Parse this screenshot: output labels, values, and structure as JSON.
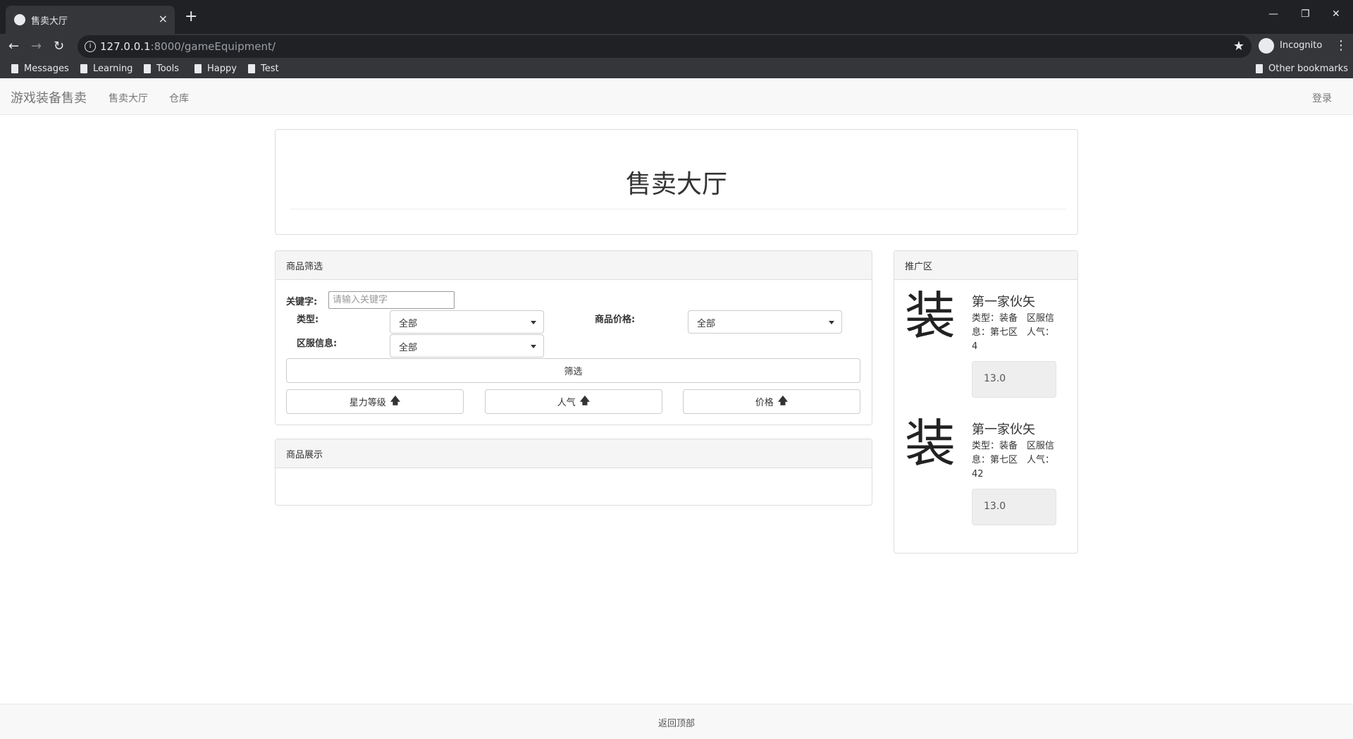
{
  "browser": {
    "tab_title": "售卖大厅",
    "tab_close": "×",
    "new_tab": "+",
    "url_host": "127.0.0.1",
    "url_rest": ":8000/gameEquipment/",
    "incognito_label": "Incognito",
    "bookmarks": [
      "Messages",
      "Learning",
      "Tools",
      "Happy",
      "Test"
    ],
    "other_bookmarks": "Other bookmarks"
  },
  "navbar": {
    "brand": "游戏装备售卖",
    "links": [
      "售卖大厅",
      "仓库"
    ],
    "login": "登录"
  },
  "header": {
    "title": "售卖大厅"
  },
  "filter": {
    "heading": "商品筛选",
    "keyword_label": "关键字:",
    "keyword_placeholder": "请输入关键字",
    "type_label": "类型:",
    "type_value": "全部",
    "price_label": "商品价格:",
    "price_value": "全部",
    "server_label": "区服信息:",
    "server_value": "全部",
    "filter_button": "筛选",
    "sort_buttons": [
      "星力等级",
      "人气",
      "价格"
    ]
  },
  "showcase": {
    "heading": "商品展示"
  },
  "promo": {
    "heading": "推广区",
    "items": [
      {
        "glyph": "装",
        "name": "第一家伙矢",
        "desc": "类型：装备　区服信息：第七区　人气：4",
        "price": "13.0"
      },
      {
        "glyph": "装",
        "name": "第一家伙矢",
        "desc": "类型：装备　区服信息：第七区　人气：42",
        "price": "13.0"
      }
    ]
  },
  "footer": {
    "back_to_top": "返回顶部"
  }
}
